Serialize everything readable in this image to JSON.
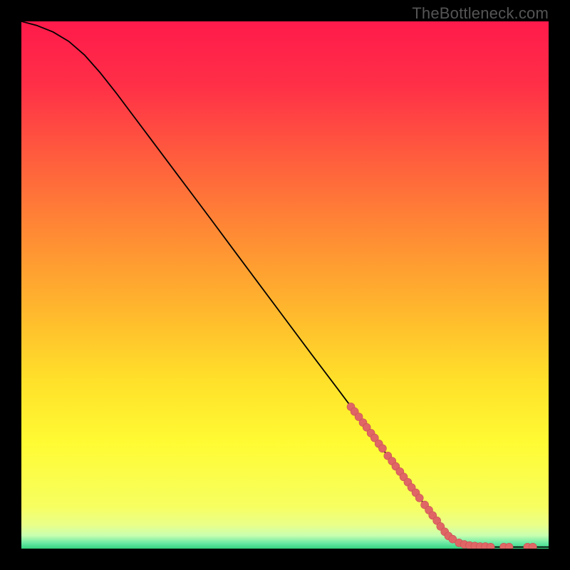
{
  "watermark": "TheBottleneck.com",
  "colors": {
    "dot_fill": "#e06666",
    "dot_stroke": "#c85050",
    "curve_stroke": "#000000",
    "frame_bg": "#000000",
    "gradient_stops": [
      {
        "offset": 0.0,
        "color": "#ff1a4b"
      },
      {
        "offset": 0.12,
        "color": "#ff2f47"
      },
      {
        "offset": 0.25,
        "color": "#ff5a3e"
      },
      {
        "offset": 0.4,
        "color": "#ff8a34"
      },
      {
        "offset": 0.55,
        "color": "#ffb82d"
      },
      {
        "offset": 0.68,
        "color": "#ffe02a"
      },
      {
        "offset": 0.8,
        "color": "#fffb33"
      },
      {
        "offset": 0.92,
        "color": "#f7ff60"
      },
      {
        "offset": 0.955,
        "color": "#eaff8a"
      },
      {
        "offset": 0.975,
        "color": "#c8ffb0"
      },
      {
        "offset": 0.99,
        "color": "#66e8a3"
      },
      {
        "offset": 1.0,
        "color": "#34d17f"
      }
    ]
  },
  "chart_data": {
    "type": "line",
    "title": "",
    "xlabel": "",
    "ylabel": "",
    "xlim": [
      0,
      100
    ],
    "ylim": [
      0,
      100
    ],
    "grid": false,
    "legend": false,
    "series": [
      {
        "name": "curve",
        "x": [
          0,
          3,
          6,
          9,
          12,
          15,
          18,
          21,
          24,
          27,
          30,
          33,
          36,
          40,
          45,
          50,
          55,
          60,
          65,
          70,
          75,
          80,
          82,
          84,
          86,
          88,
          90,
          92,
          94,
          96,
          98,
          100
        ],
        "y": [
          100,
          99.2,
          98.0,
          96.2,
          93.6,
          90.2,
          86.4,
          82.4,
          78.4,
          74.4,
          70.4,
          66.4,
          62.4,
          57.0,
          50.3,
          43.6,
          36.9,
          30.3,
          23.6,
          16.9,
          10.3,
          3.6,
          1.9,
          0.8,
          0.5,
          0.4,
          0.3,
          0.3,
          0.3,
          0.3,
          0.3,
          0.3
        ]
      }
    ],
    "dots": {
      "name": "highlight-dots",
      "x": [
        62.5,
        63.2,
        64.0,
        64.8,
        65.5,
        66.3,
        67.0,
        67.8,
        68.5,
        69.5,
        70.3,
        71.0,
        71.8,
        72.5,
        73.3,
        74.0,
        74.8,
        75.5,
        76.5,
        77.3,
        78.0,
        78.8,
        79.5,
        80.3,
        81.0,
        81.8,
        83.0,
        84.0,
        85.0,
        86.0,
        87.0,
        88.0,
        89.0,
        91.5,
        92.5,
        96.0,
        97.0
      ],
      "y": [
        26.9,
        26.0,
        25.0,
        23.9,
        23.0,
        21.9,
        21.0,
        19.9,
        19.0,
        17.6,
        16.6,
        15.6,
        14.6,
        13.6,
        12.6,
        11.6,
        10.6,
        9.6,
        8.3,
        7.3,
        6.3,
        5.3,
        4.2,
        3.2,
        2.4,
        1.8,
        1.1,
        0.8,
        0.6,
        0.5,
        0.4,
        0.4,
        0.3,
        0.3,
        0.3,
        0.3,
        0.3
      ],
      "r": 5.5
    }
  }
}
